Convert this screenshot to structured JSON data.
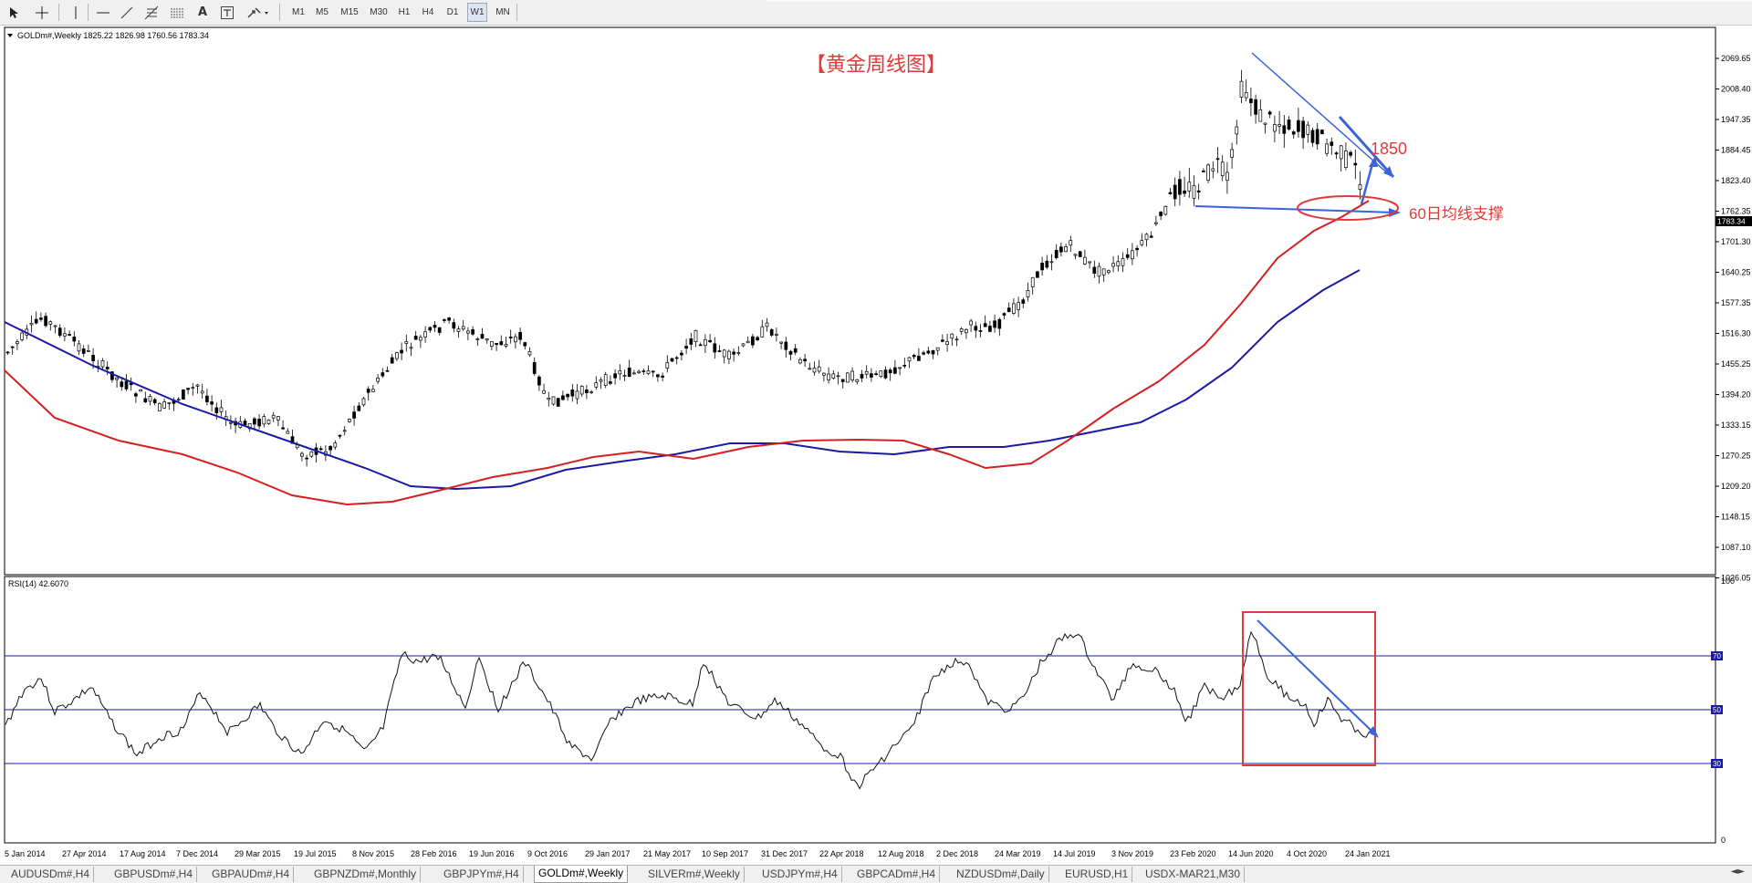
{
  "toolbar": {
    "tools": [
      "cursor-icon",
      "crosshair-icon",
      "vertical-line-icon",
      "horizontal-line-icon",
      "trendline-icon",
      "fibonacci-icon",
      "channel-icon",
      "text-icon",
      "text-label-icon",
      "arrows-icon"
    ],
    "text_tool": "A",
    "timeframes": [
      "M1",
      "M5",
      "M15",
      "M30",
      "H1",
      "H4",
      "D1",
      "W1",
      "MN"
    ],
    "active_timeframe": "W1"
  },
  "chart": {
    "info": "GOLDm#,Weekly  1825.22 1826.98 1760.56 1783.34",
    "annotation_title": "【黄金周线图】",
    "annotation_target": "1850",
    "annotation_support": "60日均线支撑",
    "current_price": "1783.34",
    "price_axis": [
      "2069.65",
      "2008.40",
      "1947.35",
      "1884.45",
      "1823.40",
      "1762.35",
      "1701.30",
      "1640.25",
      "1577.35",
      "1516.30",
      "1455.25",
      "1394.20",
      "1333.15",
      "1270.25",
      "1209.20",
      "1148.15",
      "1087.10",
      "1026.05"
    ],
    "date_axis": [
      "5 Jan 2014",
      "27 Apr 2014",
      "17 Aug 2014",
      "7 Dec 2014",
      "29 Mar 2015",
      "19 Jul 2015",
      "8 Nov 2015",
      "28 Feb 2016",
      "19 Jun 2016",
      "9 Oct 2016",
      "29 Jan 2017",
      "21 May 2017",
      "10 Sep 2017",
      "31 Dec 2017",
      "22 Apr 2018",
      "12 Aug 2018",
      "2 Dec 2018",
      "24 Mar 2019",
      "14 Jul 2019",
      "3 Nov 2019",
      "23 Feb 2020",
      "14 Jun 2020",
      "4 Oct 2020",
      "24 Jan 2021"
    ],
    "colors": {
      "ma_red": "#d42020",
      "ma_blue": "#1a1aa6",
      "annot_red": "#e03a3a",
      "annot_blue": "#3a63d8"
    }
  },
  "rsi": {
    "label": "RSI(14) 42.6070",
    "axis": [
      "100",
      "70",
      "50",
      "30",
      "0"
    ]
  },
  "tabs": [
    "AUDUSDm#,H4",
    "GBPUSDm#,H4",
    "GBPAUDm#,H4",
    "GBPNZDm#,Monthly",
    "GBPJPYm#,H4",
    "GOLDm#,Weekly",
    "SILVERm#,Weekly",
    "USDJPYm#,H4",
    "GBPCADm#,H4",
    "NZDUSDm#,Daily",
    "EURUSD,H1",
    "USDX-MAR21,M30"
  ],
  "active_tab": "GOLDm#,Weekly"
}
